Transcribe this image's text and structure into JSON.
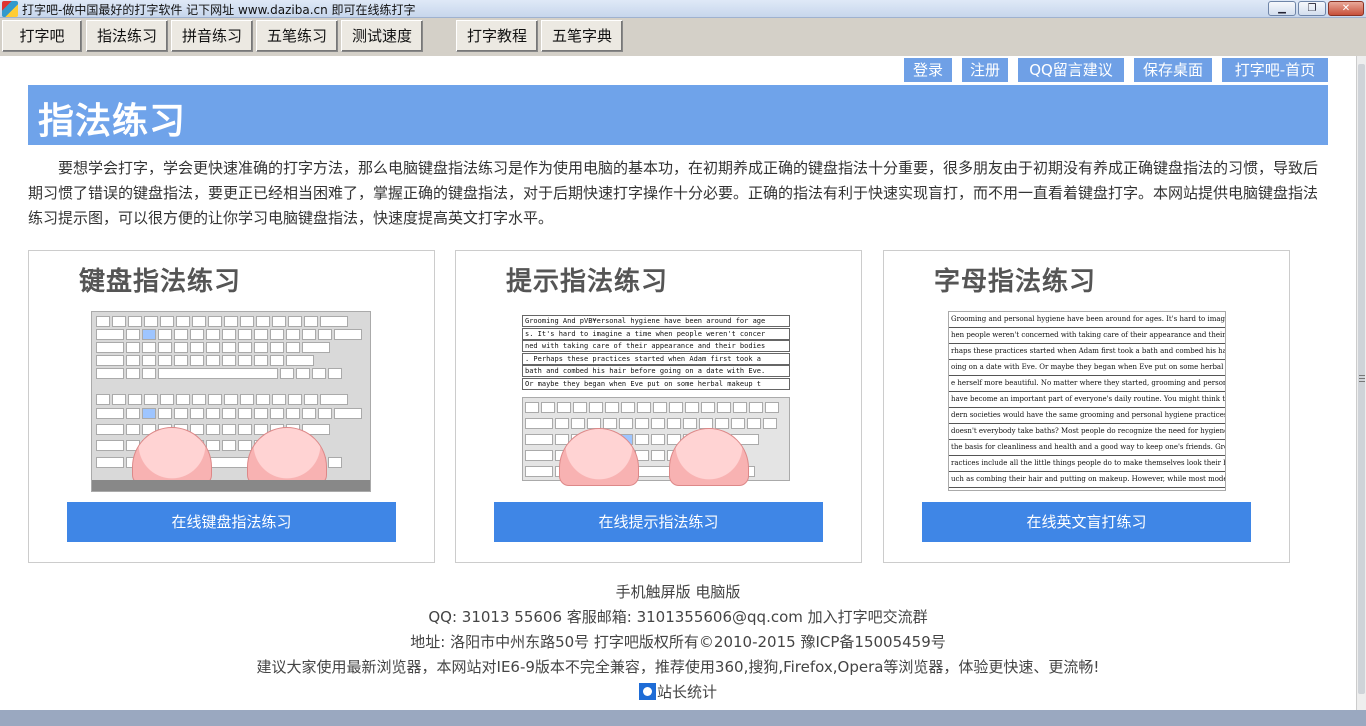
{
  "window": {
    "title": "打字吧-做中国最好的打字软件 记下网址 www.daziba.cn 即可在线练打字",
    "min_symbol": "▁",
    "max_symbol": "❐",
    "close_symbol": "✕"
  },
  "nav": {
    "items": [
      "打字吧",
      "指法练习",
      "拼音练习",
      "五笔练习",
      "测试速度",
      "打字教程",
      "五笔字典"
    ]
  },
  "toplinks": [
    "登录",
    "注册",
    "QQ留言建议",
    "保存桌面",
    "打字吧-首页"
  ],
  "banner": {
    "title": "指法练习"
  },
  "intro": "要想学会打字，学会更快速准确的打字方法，那么电脑键盘指法练习是作为使用电脑的基本功，在初期养成正确的键盘指法十分重要，很多朋友由于初期没有养成正确键盘指法的习惯，导致后期习惯了错误的键盘指法，要更正已经相当困难了，掌握正确的键盘指法，对于后期快速打字操作十分必要。正确的指法有利于快速实现盲打，而不用一直看着键盘打字。本网站提供电脑键盘指法练习提示图，可以很方便的让你学习电脑键盘指法，快速度提高英文打字水平。",
  "cards": [
    {
      "title": "键盘指法练习",
      "button": "在线键盘指法练习"
    },
    {
      "title": "提示指法练习",
      "button": "在线提示指法练习"
    },
    {
      "title": "字母指法练习",
      "button": "在线英文盲打练习"
    }
  ],
  "hint_text_lines": [
    "Grooming And pVB¥ersonal hygiene have been around for age",
    "s. It's hard to imagine a time when people weren't concer",
    "ned with taking care of their appearance and their bodies",
    ". Perhaps these practices started when Adam first took a",
    "bath and combed his hair before going on a date with Eve.",
    " Or maybe they began when Eve put on some herbal makeup t"
  ],
  "letter_text_lines": [
    "Grooming and personal hygiene have been around for ages. It's hard to imagine a time w",
    "hen people weren't concerned with taking care of their appearance and their bodies. Pe",
    "rhaps these practices started when Adam first took a bath and combed his hair before g",
    "oing on a date with Eve. Or maybe they began when Eve put on some herbal makeup to mak",
    "e herself more beautiful. No matter where they started, grooming and personal hygiene",
    "have become an important part of everyone's daily routine. You might think that all mo",
    "dern societies would have the same grooming and personal hygiene practices. After all,",
    "doesn't everybody take baths? Most people do recognize the need for hygiene, which is",
    "the basis for cleanliness and health and a good way to keep one's friends. Grooming p",
    "ractices include all the little things people do to make themselves look their best, s",
    "uch as combing their hair and putting on makeup. However, while most modern people agr"
  ],
  "footer": {
    "line1": "手机触屏版  电脑版",
    "line2": "QQ: 31013 55606 客服邮箱: 3101355606@qq.com 加入打字吧交流群",
    "line3": "地址: 洛阳市中州东路50号 打字吧版权所有©2010-2015 豫ICP备15005459号",
    "line4": "建议大家使用最新浏览器，本网站对IE6-9版本不完全兼容，推荐使用360,搜狗,Firefox,Opera等浏览器，体验更快速、更流畅!",
    "stats": "站长统计"
  }
}
